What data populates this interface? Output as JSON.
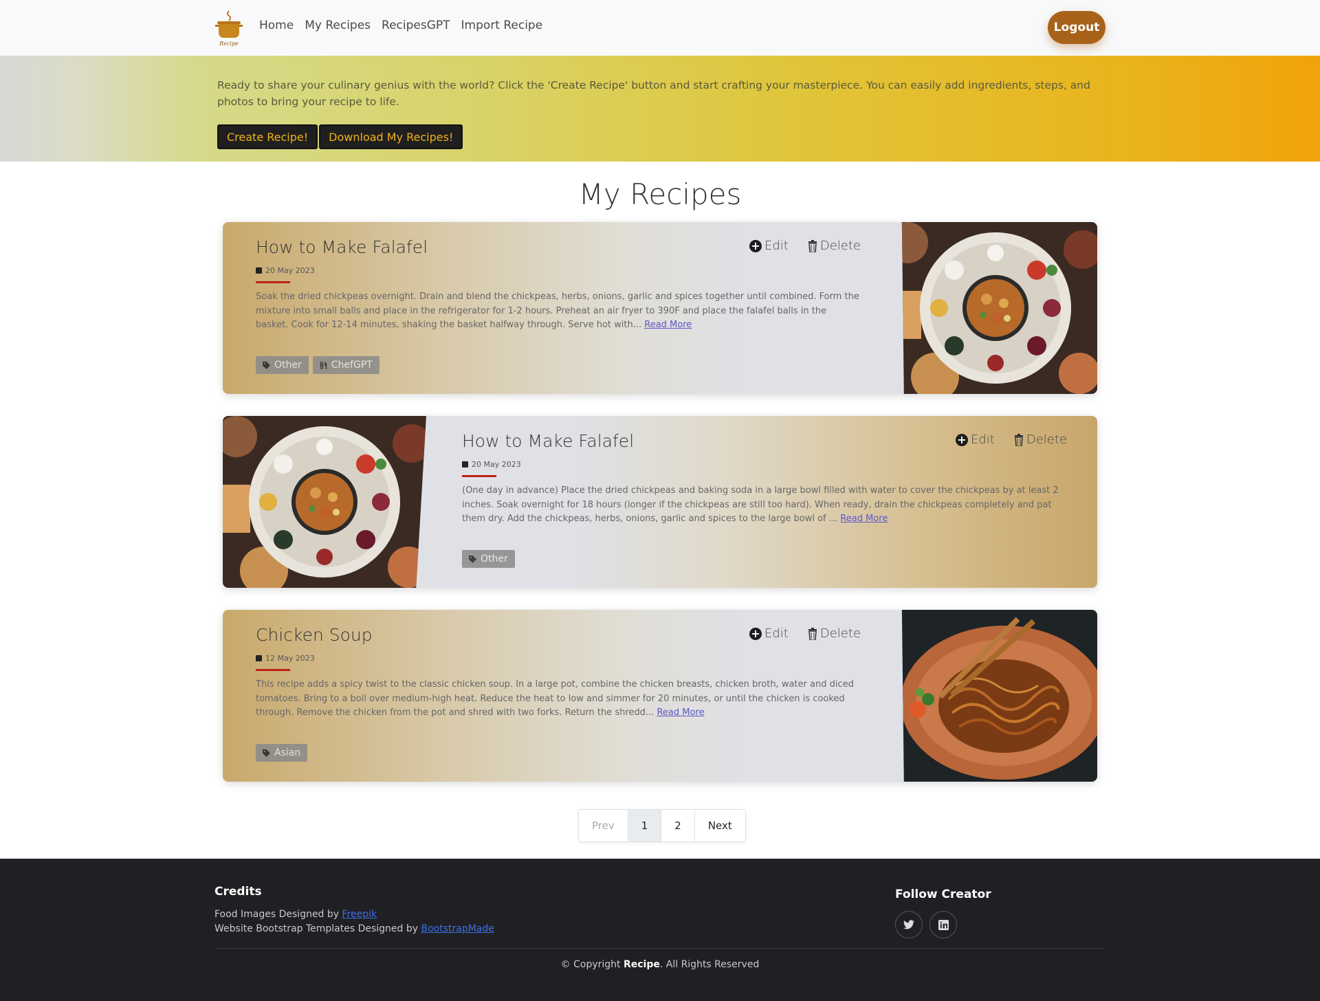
{
  "nav": {
    "logo_text": "Recipe",
    "links": [
      "Home",
      "My Recipes",
      "RecipesGPT",
      "Import Recipe"
    ],
    "logout": "Logout"
  },
  "hero": {
    "text": "Ready to share your culinary genius with the world? Click the 'Create Recipe' button and start crafting your masterpiece. You can easily add ingredients, steps, and photos to bring your recipe to life.",
    "create_btn": "Create Recipe!",
    "download_btn": "Download My Recipes!"
  },
  "page_title": "My Recipes",
  "actions": {
    "edit": "Edit",
    "delete": "Delete"
  },
  "recipes": [
    {
      "title": "How to Make Falafel",
      "date": "20 May 2023",
      "desc": "Soak the dried chickpeas overnight. Drain and blend the chickpeas, herbs, onions, garlic and spices together until combined. Form the mixture into small balls and place in the refrigerator for 1-2 hours. Preheat an air fryer to 390F and place the falafel balls in the basket. Cook for 12-14 minutes, shaking the basket halfway through. Serve hot with...",
      "read_more": "Read More",
      "tags": [
        "Other",
        "ChefGPT"
      ],
      "image": "falafel-platter"
    },
    {
      "title": "How to Make Falafel",
      "date": "20 May 2023",
      "desc": "(One day in advance) Place the dried chickpeas and baking soda in a large bowl filled with water to cover the chickpeas by at least 2 inches. Soak overnight for 18 hours (longer if the chickpeas are still too hard). When ready, drain the chickpeas completely and pat them dry. Add the chickpeas, herbs, onions, garlic and spices to the large bowl of ...",
      "read_more": "Read More",
      "tags": [
        "Other"
      ],
      "image": "falafel-platter"
    },
    {
      "title": "Chicken Soup",
      "date": "12 May 2023",
      "desc": "This recipe adds a spicy twist to the classic chicken soup. In a large pot, combine the chicken breasts, chicken broth, water and diced tomatoes. Bring to a boil over medium-high heat. Reduce the heat to low and simmer for 20 minutes, or until the chicken is cooked through. Remove the chicken from the pot and shred with two forks. Return the shredd...",
      "read_more": "Read More",
      "tags": [
        "Asian"
      ],
      "image": "noodle-plate"
    }
  ],
  "pagination": [
    "Prev",
    "1",
    "2",
    "Next"
  ],
  "footer": {
    "credits_title": "Credits",
    "credit1_prefix": "Food Images Designed by ",
    "credit1_link": "Freepik",
    "credit2_prefix": "Website Bootstrap Templates Designed by ",
    "credit2_link": "BootstrapMade",
    "follow_title": "Follow Creator",
    "copyright_prefix": "© Copyright ",
    "copyright_brand": "Recipe",
    "copyright_suffix": ". All Rights Reserved"
  },
  "colors": {
    "logout": "#a8621a",
    "hero_btn_text": "#f2b11a",
    "accent_line": "#c0201a",
    "footer_bg": "#202024"
  }
}
